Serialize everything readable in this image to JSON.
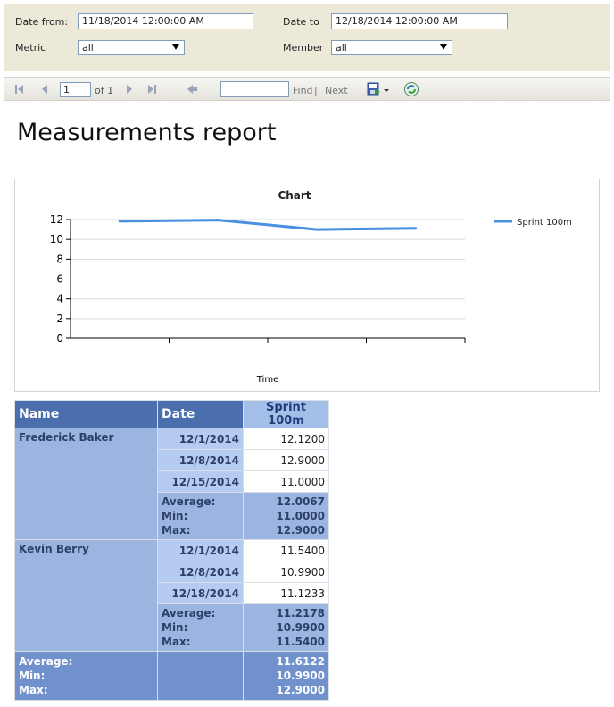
{
  "params": {
    "date_from_label": "Date from:",
    "date_from_value": "11/18/2014 12:00:00 AM",
    "date_to_label": "Date to",
    "date_to_value": "12/18/2014 12:00:00 AM",
    "metric_label": "Metric",
    "metric_value": "all",
    "member_label": "Member",
    "member_value": "all"
  },
  "toolbar": {
    "page_value": "1",
    "of_text": "of 1",
    "find_label": "Find",
    "separator": "|",
    "next_label": "Next",
    "icons": [
      "first-page-icon",
      "previous-page-icon",
      "next-page-icon",
      "last-page-icon",
      "back-icon",
      "save-export-icon",
      "refresh-icon"
    ]
  },
  "report": {
    "title": "Measurements report"
  },
  "chart_data": {
    "type": "line",
    "title": "Chart",
    "xlabel": "Time",
    "ylabel": "",
    "ylim": [
      0,
      12
    ],
    "yticks": [
      "0",
      "2",
      "4",
      "6",
      "8",
      "10",
      "12"
    ],
    "x": [
      1,
      2,
      3,
      4
    ],
    "series": [
      {
        "name": "Sprint 100m",
        "values": [
          11.83,
          11.945,
          11.0,
          11.1233
        ],
        "color": "#4a8fe0"
      }
    ],
    "legend_position": "right",
    "grid": true
  },
  "table": {
    "headers": [
      "Name",
      "Date",
      "Sprint 100m"
    ],
    "groups": [
      {
        "name": "Frederick Baker",
        "rows": [
          {
            "date": "12/1/2014",
            "value": "12.1200"
          },
          {
            "date": "12/8/2014",
            "value": "12.9000"
          },
          {
            "date": "12/15/2014",
            "value": "11.0000"
          }
        ],
        "stats": {
          "average_label": "Average:",
          "min_label": "Min:",
          "max_label": "Max:",
          "average": "12.0067",
          "min": "11.0000",
          "max": "12.9000"
        }
      },
      {
        "name": "Kevin Berry",
        "rows": [
          {
            "date": "12/1/2014",
            "value": "11.5400"
          },
          {
            "date": "12/8/2014",
            "value": "10.9900"
          },
          {
            "date": "12/18/2014",
            "value": "11.1233"
          }
        ],
        "stats": {
          "average_label": "Average:",
          "min_label": "Min:",
          "max_label": "Max:",
          "average": "11.2178",
          "min": "10.9900",
          "max": "11.5400"
        }
      }
    ],
    "total": {
      "average_label": "Average:",
      "min_label": "Min:",
      "max_label": "Max:",
      "average": "11.6122",
      "min": "10.9900",
      "max": "12.9000"
    }
  }
}
